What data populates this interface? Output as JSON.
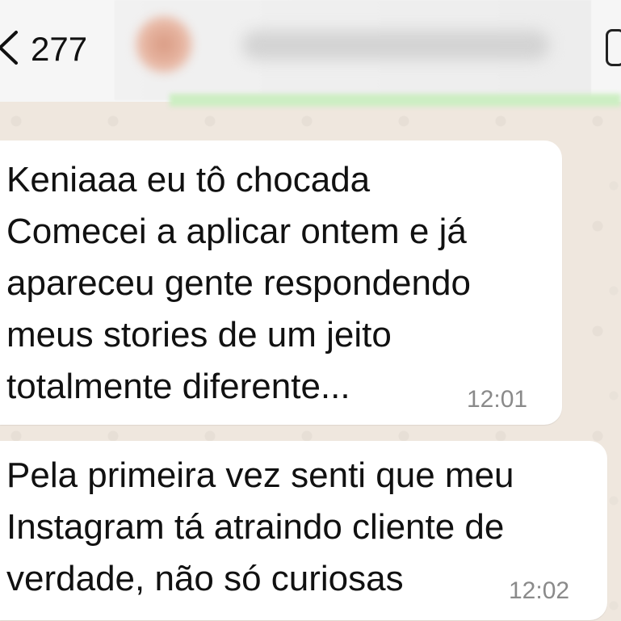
{
  "header": {
    "unread_count": "277"
  },
  "messages": [
    {
      "text": "Keniaaa eu tô chocada\nComecei a aplicar ontem e já\napareceu gente respondendo\nmeus stories de um jeito\ntotalmente diferente...",
      "time": "12:01"
    },
    {
      "text": "Pela primeira vez senti que meu\nInstagram tá atraindo cliente de\nverdade, não só curiosas",
      "time": "12:02"
    }
  ],
  "colors": {
    "chat_background": "#efe7de",
    "bubble": "#ffffff",
    "timestamp": "#8a8a8a"
  }
}
